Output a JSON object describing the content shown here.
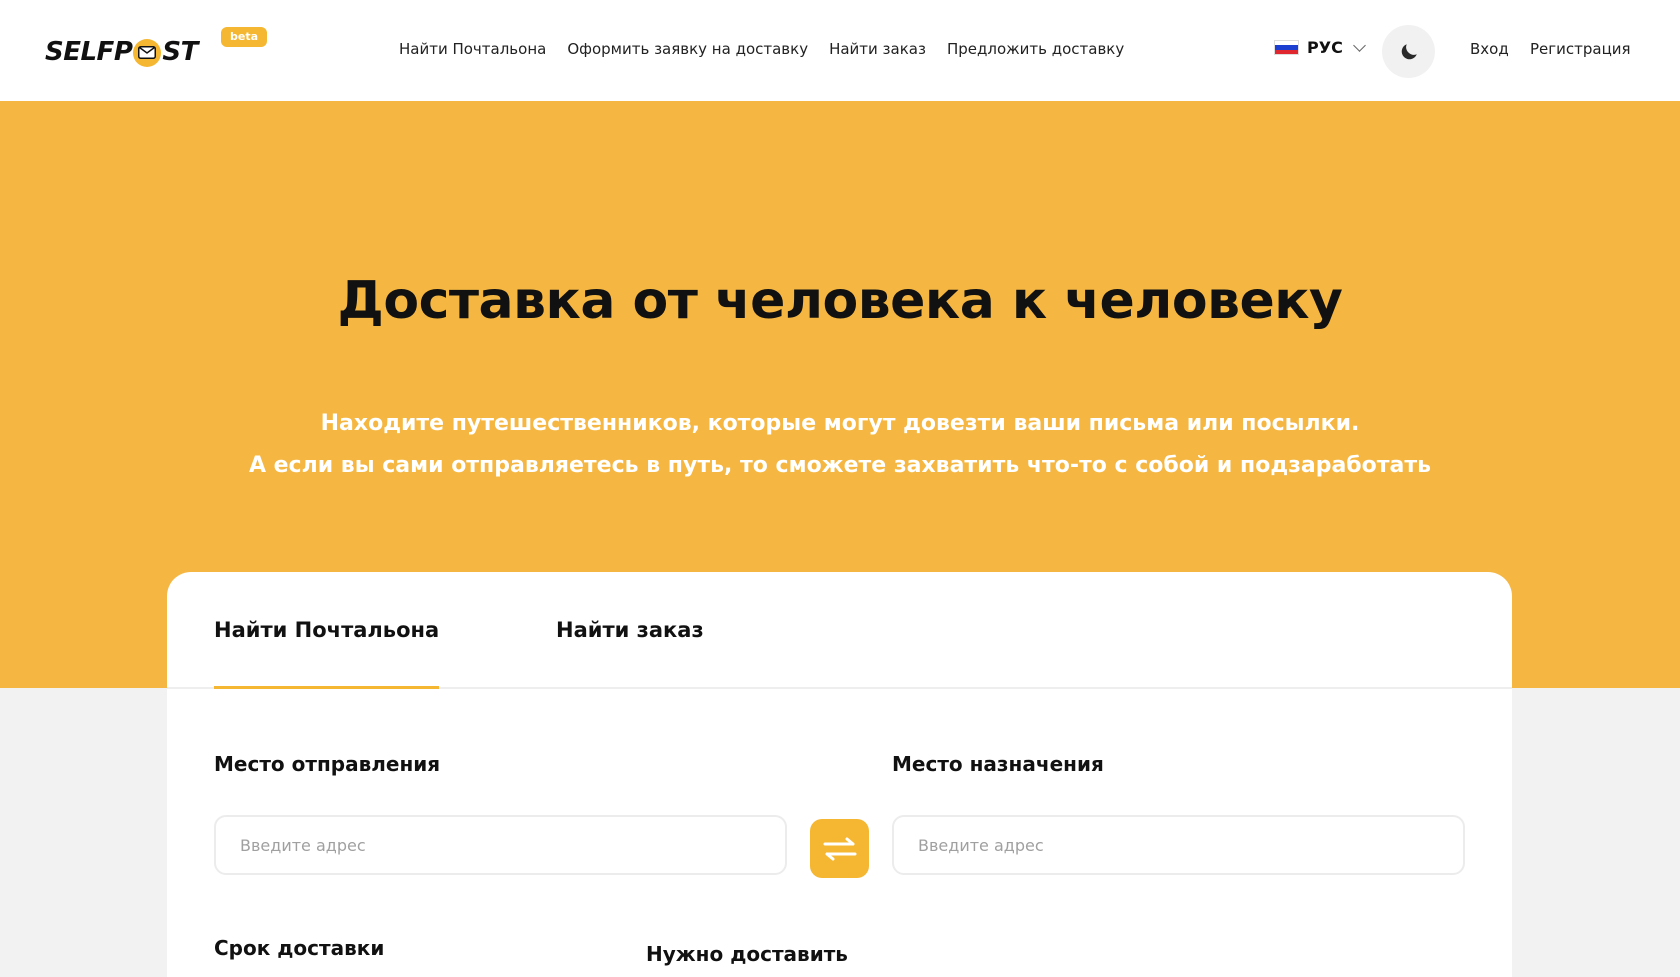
{
  "header": {
    "logo_text_left": "SELFP",
    "logo_text_right": "ST",
    "beta_badge": "beta",
    "nav": [
      {
        "label": "Найти Почтальона"
      },
      {
        "label": "Оформить заявку на доставку"
      },
      {
        "label": "Найти заказ"
      },
      {
        "label": "Предложить доставку"
      }
    ],
    "language": {
      "label": "РУС",
      "flag_colors": [
        "#ffffff",
        "#1c3ed1",
        "#e0262e"
      ]
    },
    "theme_icon": "moon-icon",
    "login_label": "Вход",
    "register_label": "Регистрация"
  },
  "hero": {
    "title": "Доставка от человека к человеку",
    "subtitle_line1": "Находите путешественников, которые могут довезти ваши письма или посылки.",
    "subtitle_line2": "А если вы сами отправляетесь в путь, то сможете захватить что-то с собой и подзаработать"
  },
  "search_card": {
    "tabs": [
      {
        "label": "Найти Почтальона",
        "active": true
      },
      {
        "label": "Найти заказ",
        "active": false
      }
    ],
    "from": {
      "label": "Место отправления",
      "placeholder": "Введите адрес",
      "value": ""
    },
    "to": {
      "label": "Место назначения",
      "placeholder": "Введите адрес",
      "value": ""
    },
    "swap_icon": "swap-arrows-icon",
    "delivery_date_label": "Срок доставки",
    "need_deliver_label": "Нужно доставить"
  },
  "colors": {
    "accent": "#f5b731",
    "hero_bg": "#f5b741",
    "page_bg": "#f2f2f2"
  }
}
